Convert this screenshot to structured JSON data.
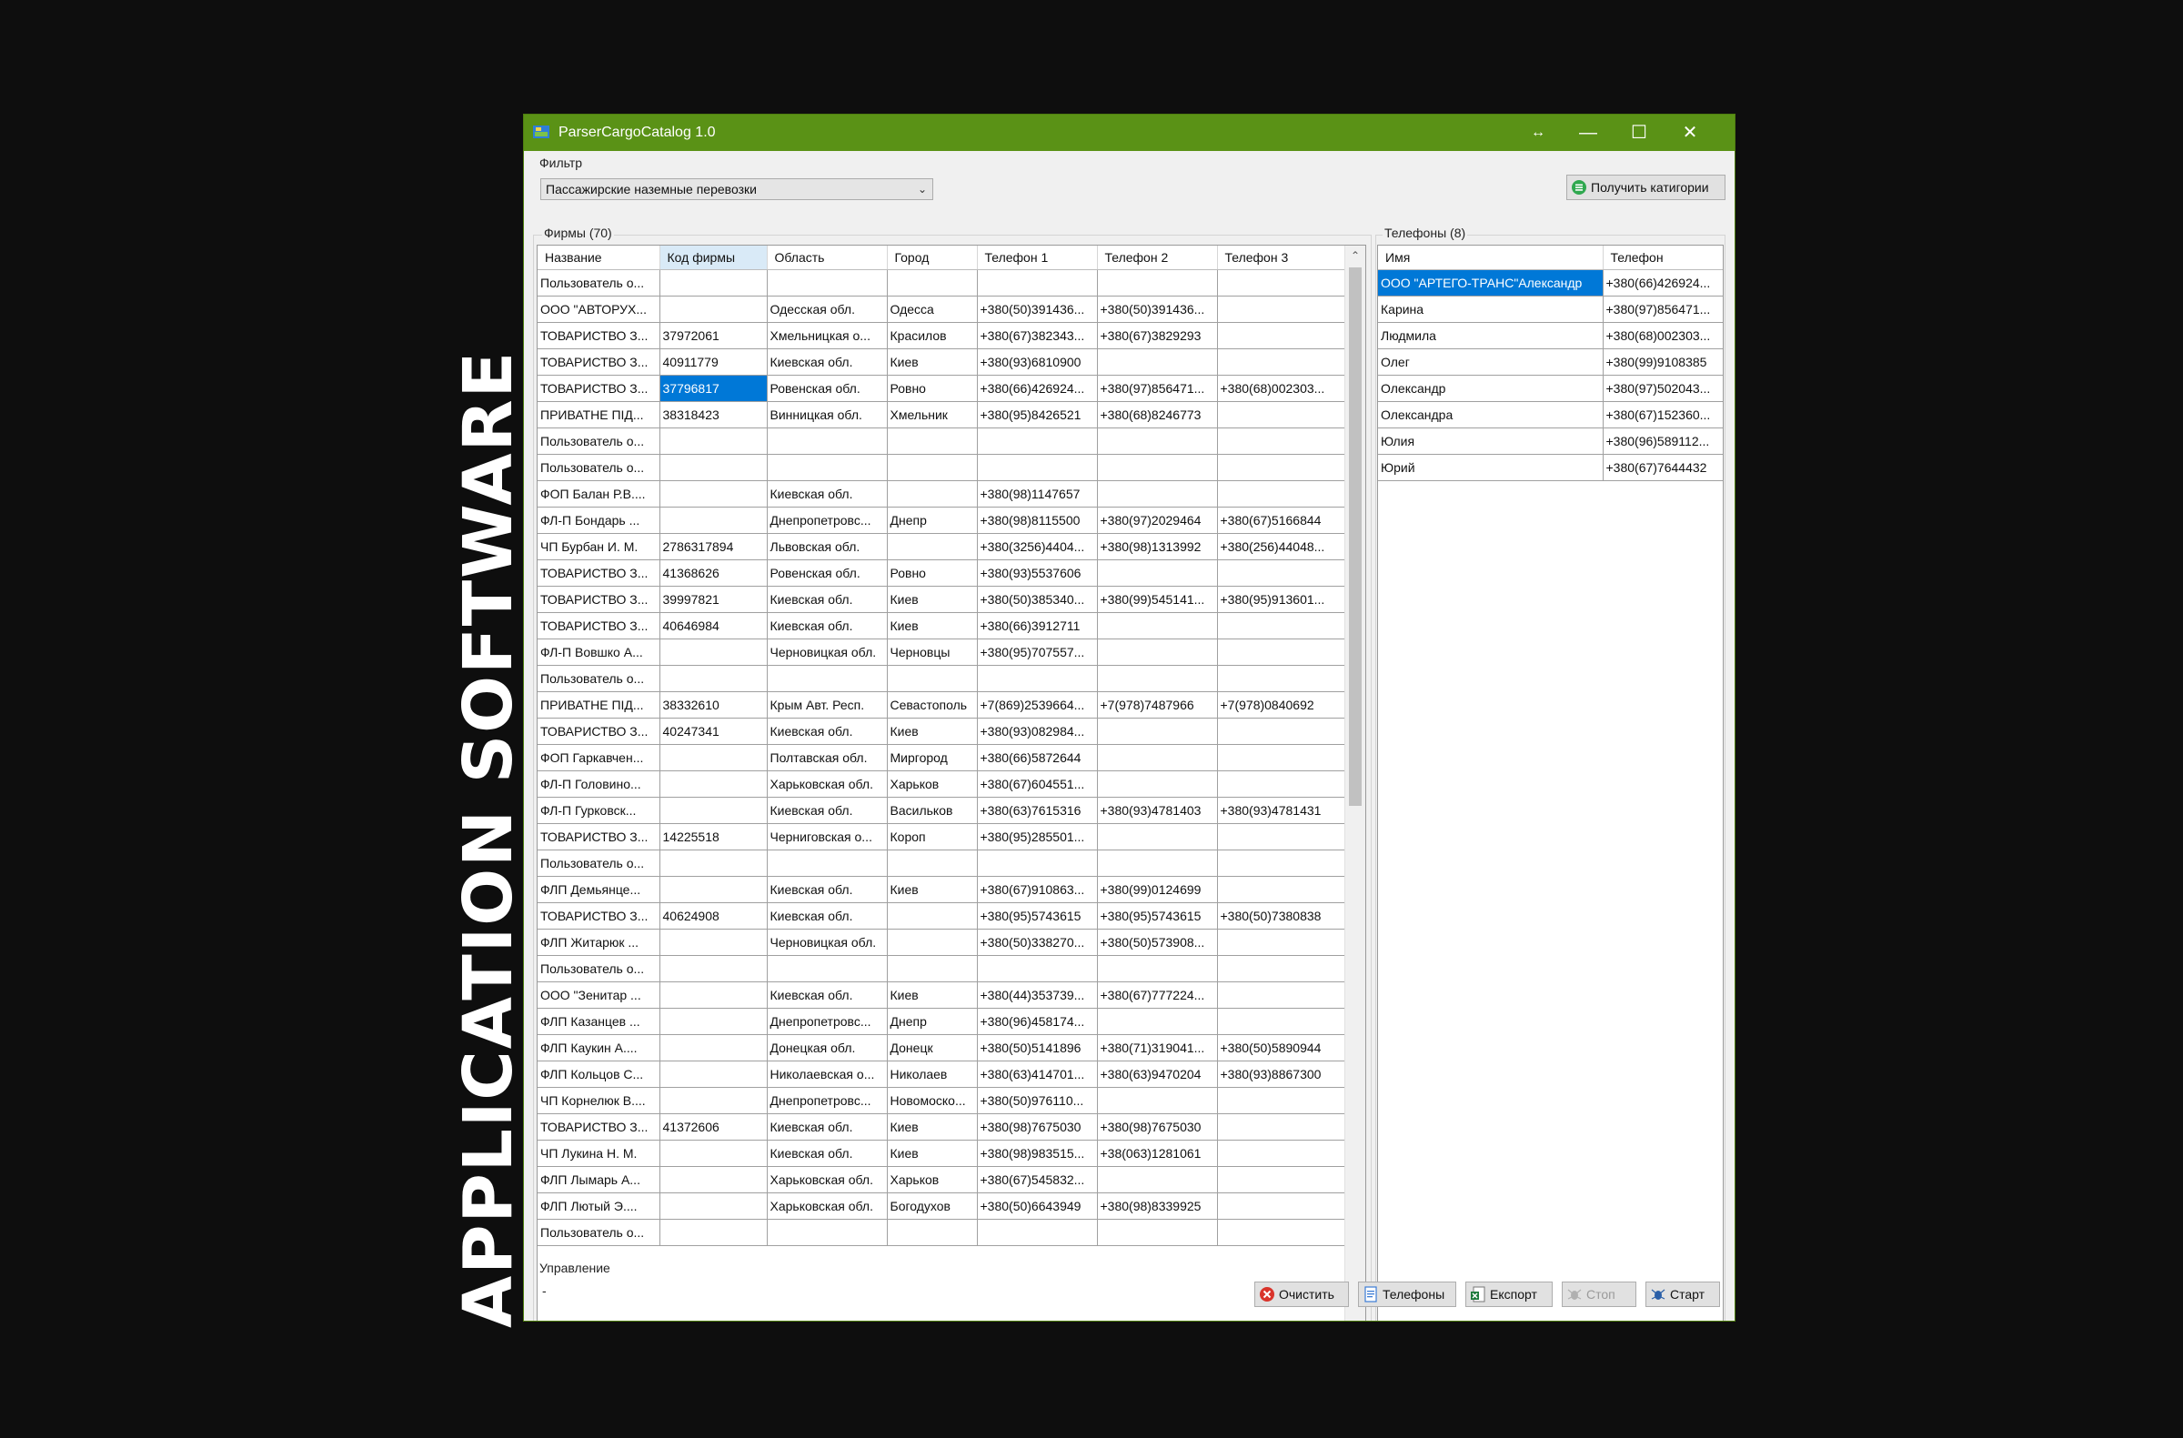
{
  "side_text": "APPLICATION SOFTWARE",
  "window": {
    "title": "ParserCargoCatalog 1.0",
    "controls": {
      "resize": "↔",
      "minimize": "—",
      "maximize": "☐",
      "close": "✕"
    }
  },
  "filter": {
    "group_label": "Фильтр",
    "selected": "Пассажирские наземные перевозки",
    "get_categories_label": "Получить катигории"
  },
  "firms": {
    "group_label": "Фирмы (70)",
    "columns": [
      "Название",
      "Код фирмы",
      "Область",
      "Город",
      "Телефон 1",
      "Телефон 2",
      "Телефон 3"
    ],
    "rows": [
      [
        "Пользователь о...",
        "",
        "",
        "",
        "",
        "",
        ""
      ],
      [
        "ООО \"АВТОРУХ...",
        "",
        "Одесская обл.",
        "Одесса",
        "+380(50)391436...",
        "+380(50)391436...",
        ""
      ],
      [
        "ТОВАРИСТВО З...",
        "37972061",
        "Хмельницкая о...",
        "Красилов",
        "+380(67)382343...",
        "+380(67)3829293",
        ""
      ],
      [
        "ТОВАРИСТВО З...",
        "40911779",
        "Киевская обл.",
        "Киев",
        "+380(93)6810900",
        "",
        ""
      ],
      [
        "ТОВАРИСТВО З...",
        "37796817",
        "Ровенская обл.",
        "Ровно",
        "+380(66)426924...",
        "+380(97)856471...",
        "+380(68)002303..."
      ],
      [
        "ПРИВАТНЕ ПІД...",
        "38318423",
        "Винницкая обл.",
        "Хмельник",
        "+380(95)8426521",
        "+380(68)8246773",
        ""
      ],
      [
        "Пользователь о...",
        "",
        "",
        "",
        "",
        "",
        ""
      ],
      [
        "Пользователь о...",
        "",
        "",
        "",
        "",
        "",
        ""
      ],
      [
        "ФОП Балан Р.В....",
        "",
        "Киевская обл.",
        "",
        "+380(98)1147657",
        "",
        ""
      ],
      [
        "ФЛ-П Бондарь ...",
        "",
        "Днепропетровс...",
        "Днепр",
        "+380(98)8115500",
        "+380(97)2029464",
        "+380(67)5166844"
      ],
      [
        "ЧП Бурбан И. М.",
        "2786317894",
        "Львовская обл.",
        "",
        "+380(3256)4404...",
        "+380(98)1313992",
        "+380(256)44048..."
      ],
      [
        "ТОВАРИСТВО З...",
        "41368626",
        "Ровенская обл.",
        "Ровно",
        "+380(93)5537606",
        "",
        ""
      ],
      [
        "ТОВАРИСТВО З...",
        "39997821",
        "Киевская обл.",
        "Киев",
        "+380(50)385340...",
        "+380(99)545141...",
        "+380(95)913601..."
      ],
      [
        "ТОВАРИСТВО З...",
        "40646984",
        "Киевская обл.",
        "Киев",
        "+380(66)3912711",
        "",
        ""
      ],
      [
        "ФЛ-П Вовшко А...",
        "",
        "Черновицкая обл.",
        "Черновцы",
        "+380(95)707557...",
        "",
        ""
      ],
      [
        "Пользователь о...",
        "",
        "",
        "",
        "",
        "",
        ""
      ],
      [
        "ПРИВАТНЕ ПІД...",
        "38332610",
        "Крым Авт. Респ.",
        "Севастополь",
        "+7(869)2539664...",
        "+7(978)7487966",
        "+7(978)0840692"
      ],
      [
        "ТОВАРИСТВО З...",
        "40247341",
        "Киевская обл.",
        "Киев",
        "+380(93)082984...",
        "",
        ""
      ],
      [
        "ФОП Гаркавчен...",
        "",
        "Полтавская обл.",
        "Миргород",
        "+380(66)5872644",
        "",
        ""
      ],
      [
        "ФЛ-П Головино...",
        "",
        "Харьковская обл.",
        "Харьков",
        "+380(67)604551...",
        "",
        ""
      ],
      [
        "ФЛ-П Гурковск...",
        "",
        "Киевская обл.",
        "Васильков",
        "+380(63)7615316",
        "+380(93)4781403",
        "+380(93)4781431"
      ],
      [
        "ТОВАРИСТВО З...",
        "14225518",
        "Черниговская о...",
        "Короп",
        "+380(95)285501...",
        "",
        ""
      ],
      [
        "Пользователь о...",
        "",
        "",
        "",
        "",
        "",
        ""
      ],
      [
        "ФЛП Демьянце...",
        "",
        "Киевская обл.",
        "Киев",
        "+380(67)910863...",
        "+380(99)0124699",
        ""
      ],
      [
        "ТОВАРИСТВО З...",
        "40624908",
        "Киевская обл.",
        "",
        "+380(95)5743615",
        "+380(95)5743615",
        "+380(50)7380838"
      ],
      [
        "ФЛП Житарюк ...",
        "",
        "Черновицкая обл.",
        "",
        "+380(50)338270...",
        "+380(50)573908...",
        ""
      ],
      [
        "Пользователь о...",
        "",
        "",
        "",
        "",
        "",
        ""
      ],
      [
        "ООО \"Зенитар ...",
        "",
        "Киевская обл.",
        "Киев",
        "+380(44)353739...",
        "+380(67)777224...",
        ""
      ],
      [
        "ФЛП Казанцев ...",
        "",
        "Днепропетровс...",
        "Днепр",
        "+380(96)458174...",
        "",
        ""
      ],
      [
        "ФЛП Каукин А....",
        "",
        "Донецкая обл.",
        "Донецк",
        "+380(50)5141896",
        "+380(71)319041...",
        "+380(50)5890944"
      ],
      [
        "ФЛП Кольцов С...",
        "",
        "Николаевская о...",
        "Николаев",
        "+380(63)414701...",
        "+380(63)9470204",
        "+380(93)8867300"
      ],
      [
        "ЧП Корнелюк В....",
        "",
        "Днепропетровс...",
        "Новомоско...",
        "+380(50)976110...",
        "",
        ""
      ],
      [
        "ТОВАРИСТВО З...",
        "41372606",
        "Киевская обл.",
        "Киев",
        "+380(98)7675030",
        "+380(98)7675030",
        ""
      ],
      [
        "ЧП Лукина Н. М.",
        "",
        "Киевская обл.",
        "Киев",
        "+380(98)983515...",
        "+38(063)1281061",
        ""
      ],
      [
        "ФЛП Лымарь А...",
        "",
        "Харьковская обл.",
        "Харьков",
        "+380(67)545832...",
        "",
        ""
      ],
      [
        "ФЛП Лютый Э....",
        "",
        "Харьковская обл.",
        "Богодухов",
        "+380(50)6643949",
        "+380(98)8339925",
        ""
      ],
      [
        "Пользователь о...",
        "",
        "",
        "",
        "",
        "",
        ""
      ]
    ]
  },
  "phones": {
    "group_label": "Телефоны (8)",
    "columns": [
      "Имя",
      "Телефон"
    ],
    "rows": [
      [
        "ООО \"АРТЕГО-ТРАНС\"Александр",
        "+380(66)426924..."
      ],
      [
        "Карина",
        "+380(97)856471..."
      ],
      [
        "Людмила",
        "+380(68)002303..."
      ],
      [
        "Олег",
        "+380(99)9108385"
      ],
      [
        "Олександр",
        "+380(97)502043..."
      ],
      [
        "Олександра",
        "+380(67)152360..."
      ],
      [
        "Юлия",
        "+380(96)589112..."
      ],
      [
        "Юрий",
        "+380(67)7644432"
      ]
    ]
  },
  "control": {
    "group_label": "Управление",
    "status": "-",
    "buttons": {
      "clear": "Очистить",
      "phones": "Телефоны",
      "export": "Експорт",
      "stop": "Стоп",
      "start": "Старт"
    }
  },
  "colors": {
    "titlebar": "#5a9216",
    "selection": "#0078d7",
    "background": "#0e0e0e"
  }
}
